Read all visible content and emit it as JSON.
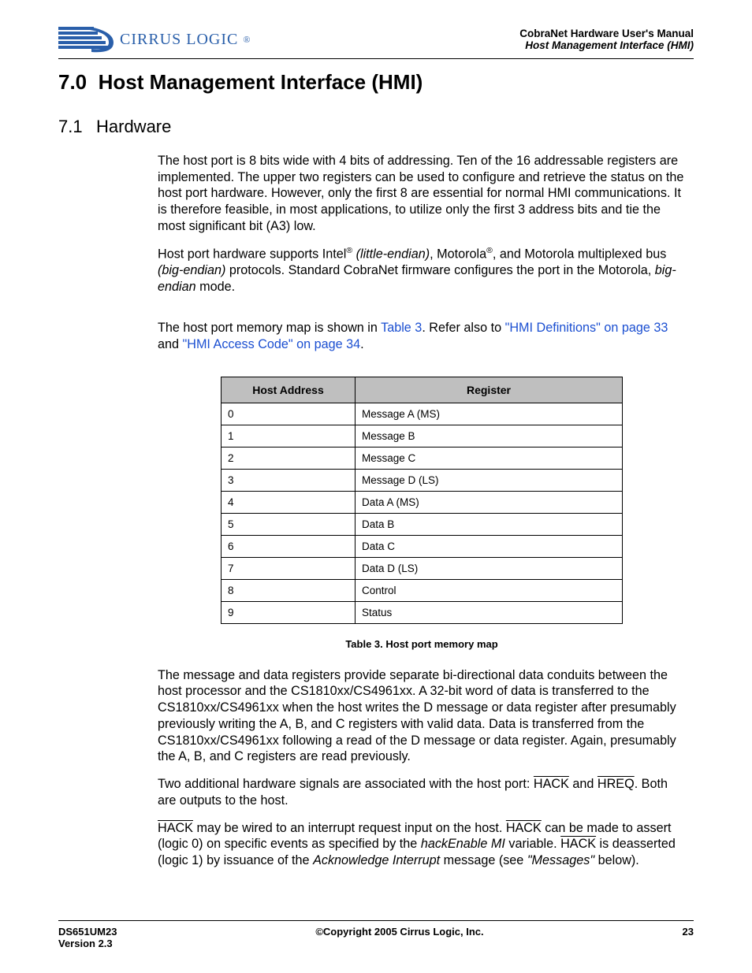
{
  "header": {
    "logo_brand": "CIRRUS LOGIC",
    "doc_title": "CobraNet Hardware User's Manual",
    "doc_subtitle": "Host Management Interface (HMI)"
  },
  "section": {
    "number": "7.0",
    "title": "Host Management Interface (HMI)"
  },
  "subsection": {
    "number": "7.1",
    "title": "Hardware"
  },
  "paragraphs": {
    "p1": "The host port is 8 bits wide with 4 bits of addressing. Ten of the 16 addressable registers are implemented. The upper two registers can be used to configure and retrieve the status on the host port hardware. However, only the first 8 are essential for normal HMI communications. It is therefore feasible, in most applications, to utilize only the first 3 address bits and tie the most significant bit (A3) low.",
    "p2_a": "Host port hardware supports Intel",
    "p2_reg": "®",
    "p2_b": " ",
    "p2_italic1": "(little-endian)",
    "p2_c": ", Motorola",
    "p2_d": ", and Motorola multiplexed bus ",
    "p2_italic2": "(big-endian)",
    "p2_e": " protocols. Standard CobraNet firmware configures the port in the Motorola, ",
    "p2_italic3": "big-endian",
    "p2_f": " mode.",
    "p3_a": "The host port memory map is shown in ",
    "p3_link1": "Table 3",
    "p3_b": ". Refer also to ",
    "p3_link2": "\"HMI Definitions\" on page 33",
    "p3_c": " and ",
    "p3_link3": "\"HMI Access Code\" on page 34",
    "p3_d": ".",
    "p4": "The message and data registers provide separate bi-directional data conduits between the host processor and the CS1810xx/CS4961xx. A 32-bit word of data is transferred to the CS1810xx/CS4961xx when the host writes the D message or data register after presumably previously writing the A, B, and C registers with valid data. Data is transferred from the CS1810xx/CS4961xx following a read of the D message or data register. Again, presumably the A, B, and C registers are read previously.",
    "p5_a": "Two additional hardware signals are associated with the host port: ",
    "p5_sig1": "HACK",
    "p5_b": " and ",
    "p5_sig2": "HREQ",
    "p5_c": ". Both are outputs to the host.",
    "p6_sig1": "HACK",
    "p6_a": " may be wired to an interrupt request input on the host. ",
    "p6_sig2": "HACK",
    "p6_b": " can be made to assert (logic 0) on specific events as specified by the ",
    "p6_italic1": "hackEnable MI",
    "p6_c": " variable. ",
    "p6_sig3": "HACK",
    "p6_d": " is deasserted (logic 1) by issuance of the ",
    "p6_italic2": "Acknowledge Interrupt",
    "p6_e": " message (see ",
    "p6_italic3": "\"Messages\"",
    "p6_f": " below)."
  },
  "table": {
    "col1_header": "Host Address",
    "col2_header": "Register",
    "rows": [
      {
        "addr": "0",
        "reg": "Message A (MS)"
      },
      {
        "addr": "1",
        "reg": "Message B"
      },
      {
        "addr": "2",
        "reg": "Message C"
      },
      {
        "addr": "3",
        "reg": "Message D (LS)"
      },
      {
        "addr": "4",
        "reg": "Data A (MS)"
      },
      {
        "addr": "5",
        "reg": "Data B"
      },
      {
        "addr": "6",
        "reg": "Data C"
      },
      {
        "addr": "7",
        "reg": "Data D (LS)"
      },
      {
        "addr": "8",
        "reg": "Control"
      },
      {
        "addr": "9",
        "reg": "Status"
      }
    ],
    "caption": "Table 3. Host port memory map"
  },
  "footer": {
    "left1": "DS651UM23",
    "left2": "Version 2.3",
    "center": "©Copyright 2005 Cirrus Logic, Inc.",
    "right": "23"
  }
}
